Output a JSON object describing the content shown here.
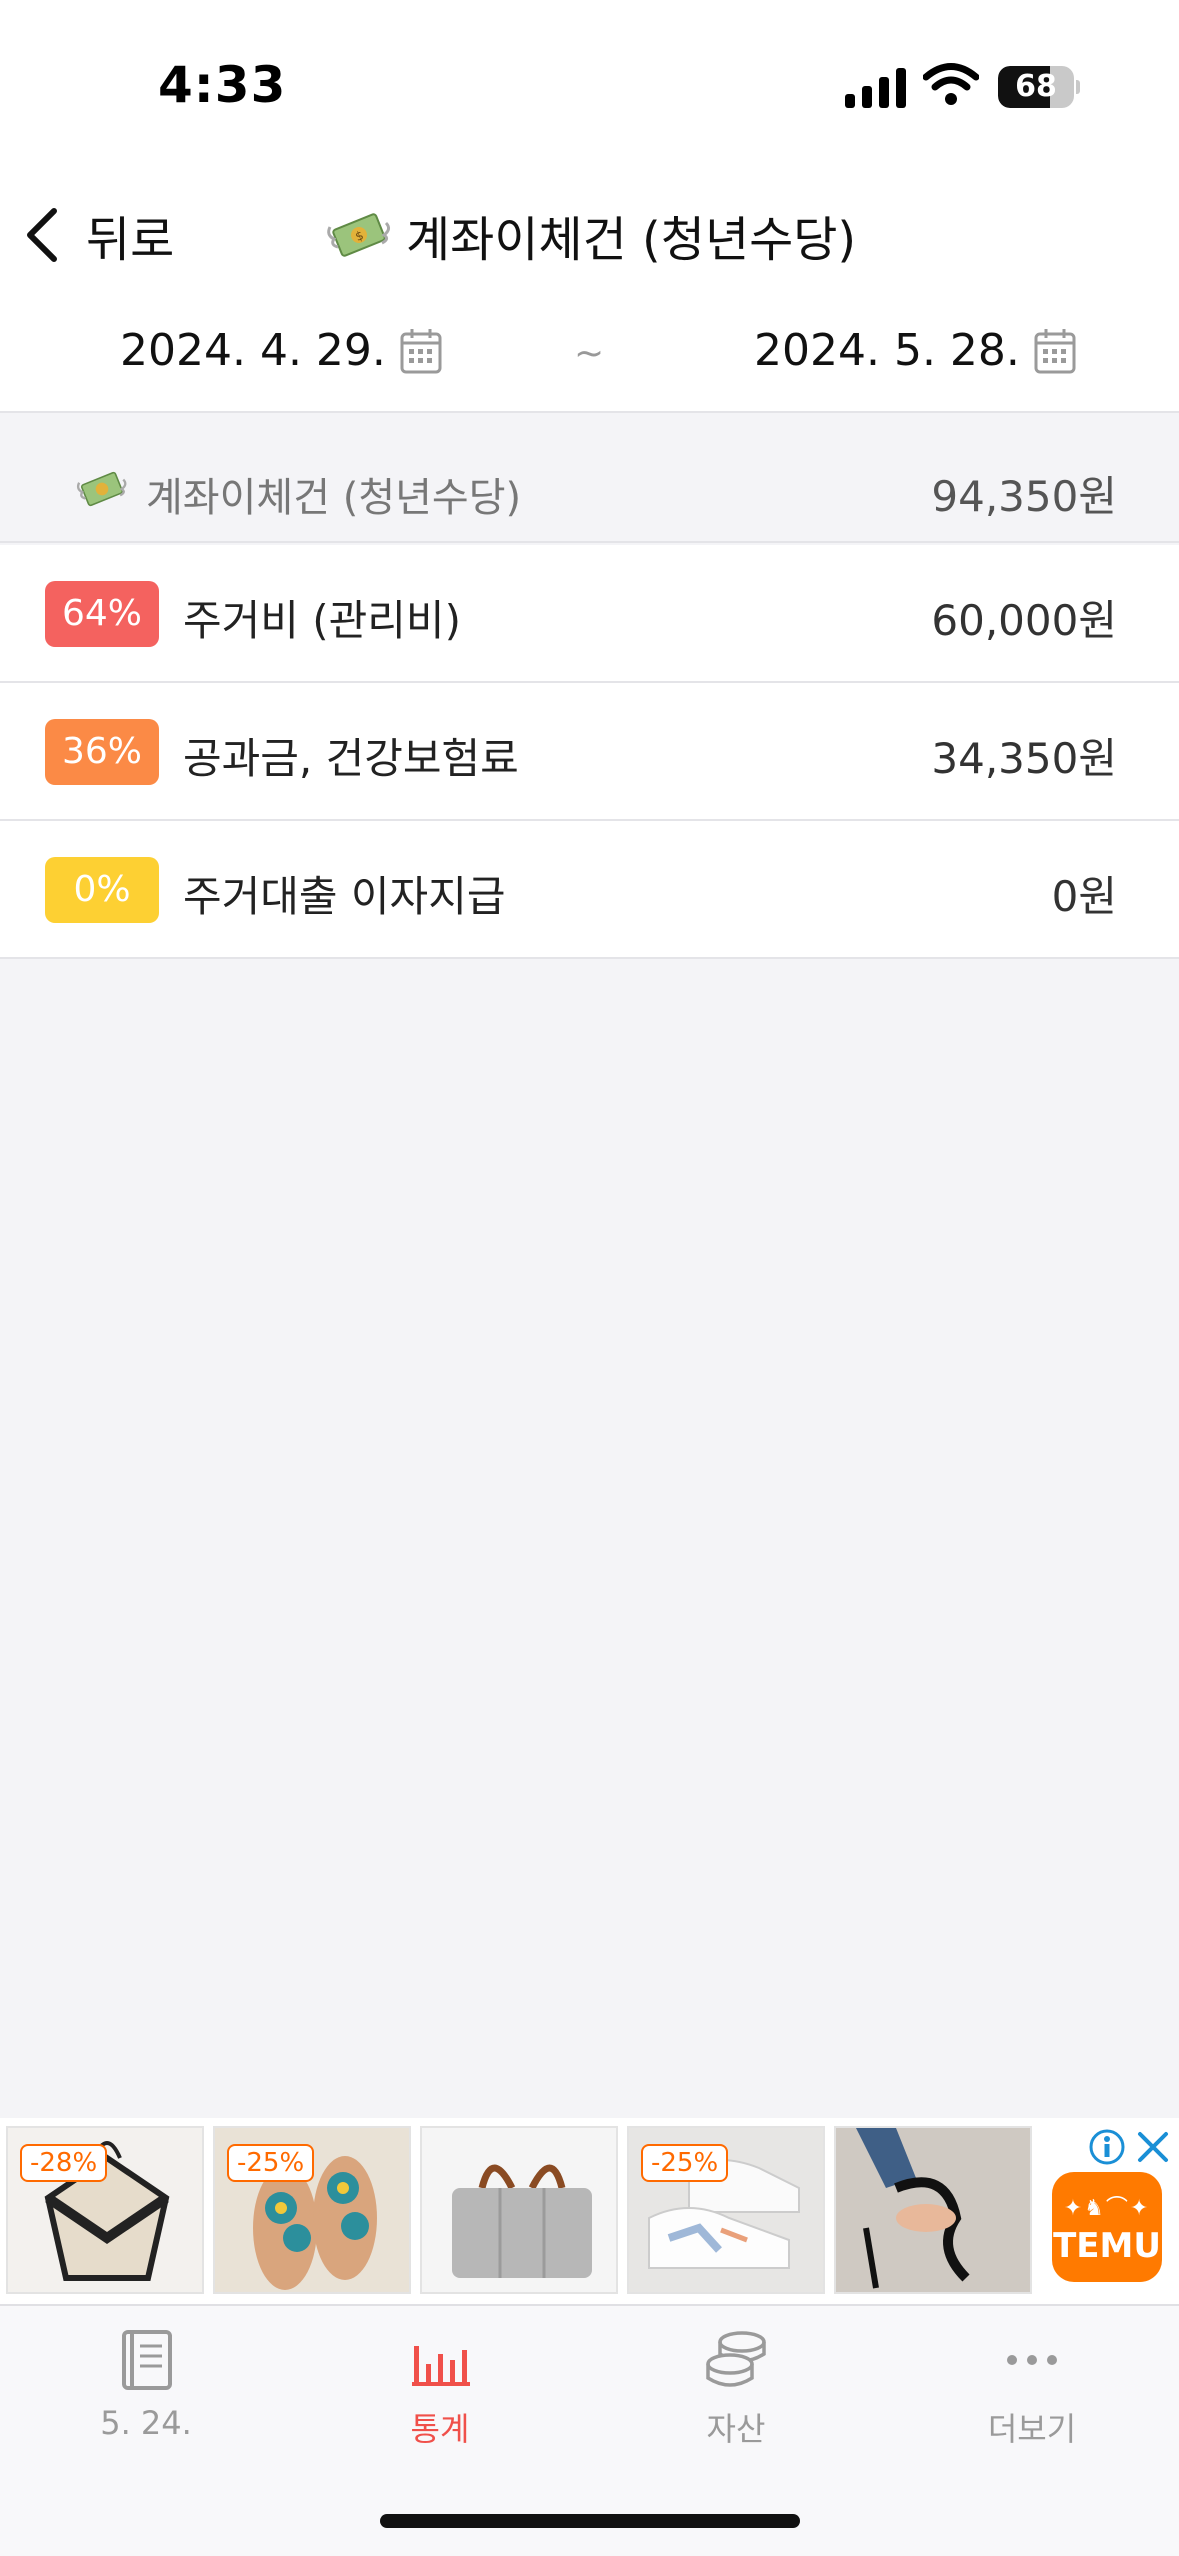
{
  "status_bar": {
    "time": "4:33",
    "battery_level": "68",
    "battery_fraction": 0.68
  },
  "nav": {
    "back_label": "뒤로",
    "title": "계좌이체건 (청년수당)",
    "title_icon": "money-with-wings-icon"
  },
  "date_range": {
    "start": "2024. 4. 29.",
    "separator": "~",
    "end": "2024. 5. 28."
  },
  "summary": {
    "label": "계좌이체건 (청년수당)",
    "amount": "94,350원"
  },
  "items": [
    {
      "percent": "64%",
      "label": "주거비 (관리비)",
      "amount": "60,000원",
      "color": "#f4625f"
    },
    {
      "percent": "36%",
      "label": "공과금, 건강보험료",
      "amount": "34,350원",
      "color": "#fb8a46"
    },
    {
      "percent": "0%",
      "label": "주거대출 이자지급",
      "amount": "0원",
      "color": "#fdd033"
    }
  ],
  "ad": {
    "tiles": [
      {
        "discount": "-28%",
        "icon": "tote-bag-image"
      },
      {
        "discount": "-25%",
        "icon": "sandals-image"
      },
      {
        "discount": "",
        "icon": "felt-organizer-bag-image"
      },
      {
        "discount": "-25%",
        "icon": "sneakers-image"
      },
      {
        "discount": "",
        "icon": "high-heels-image"
      }
    ],
    "brand": "TEMU"
  },
  "tabs": [
    {
      "label": "5. 24.",
      "icon": "book-icon",
      "active": false
    },
    {
      "label": "통계",
      "icon": "bar-chart-icon",
      "active": true
    },
    {
      "label": "자산",
      "icon": "coins-icon",
      "active": false
    },
    {
      "label": "더보기",
      "icon": "more-dots-icon",
      "active": false
    }
  ],
  "colors": {
    "accent": "#f0504a",
    "background": "#f4f4f7"
  }
}
